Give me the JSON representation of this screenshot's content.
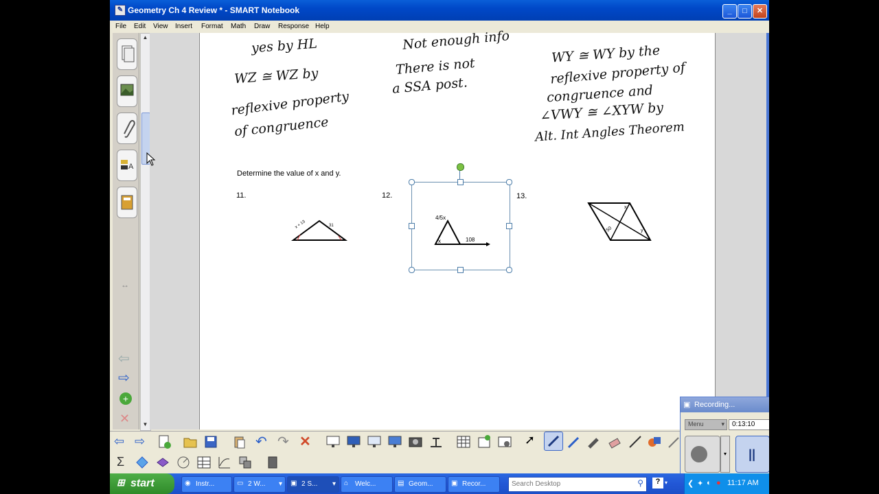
{
  "window": {
    "title": "Geometry Ch 4 Review * - SMART Notebook",
    "app_icon": "smart-notebook-icon",
    "controls": [
      "minimize-icon",
      "maximize-icon",
      "close-icon"
    ]
  },
  "menu": [
    "File",
    "Edit",
    "View",
    "Insert",
    "Format",
    "Math",
    "Draw",
    "Response",
    "Help"
  ],
  "handwriting": {
    "col1": [
      "yes by HL",
      "WZ ≅ WZ by",
      "reflexive property",
      "of congruence"
    ],
    "col2": [
      "Not enough info",
      "There is not",
      "a SSA post."
    ],
    "col3": [
      "WY ≅ WY by the",
      "reflexive property of",
      "congruence and",
      "∠VWY ≅ ∠XYW by",
      "Alt. Int Angles Theorem"
    ]
  },
  "problem": {
    "instruction": "Determine the value of x and y.",
    "numbers": [
      "11.",
      "12.",
      "13."
    ],
    "fig11_labels": [
      "x + 13",
      "31"
    ],
    "fig12_labels": [
      "4/5x",
      "x",
      "108"
    ],
    "fig13_labels": [
      "x",
      "50",
      "y"
    ]
  },
  "recorder": {
    "title": "Recording...",
    "dropdown": "Menu",
    "time": "0:13:10"
  },
  "taskbar": {
    "start": "start",
    "tasks": [
      "Instr...",
      "2 W...",
      "2 S...",
      "Welc...",
      "Geom...",
      "Recor..."
    ],
    "search_placeholder": "Search Desktop",
    "clock": "11:17 AM"
  },
  "colors": {
    "titlebar": "#0048c8",
    "selection_handle_green": "#7cc142",
    "page": "#ffffff",
    "taskbar": "#2257d6",
    "start": "#2f8a29"
  }
}
